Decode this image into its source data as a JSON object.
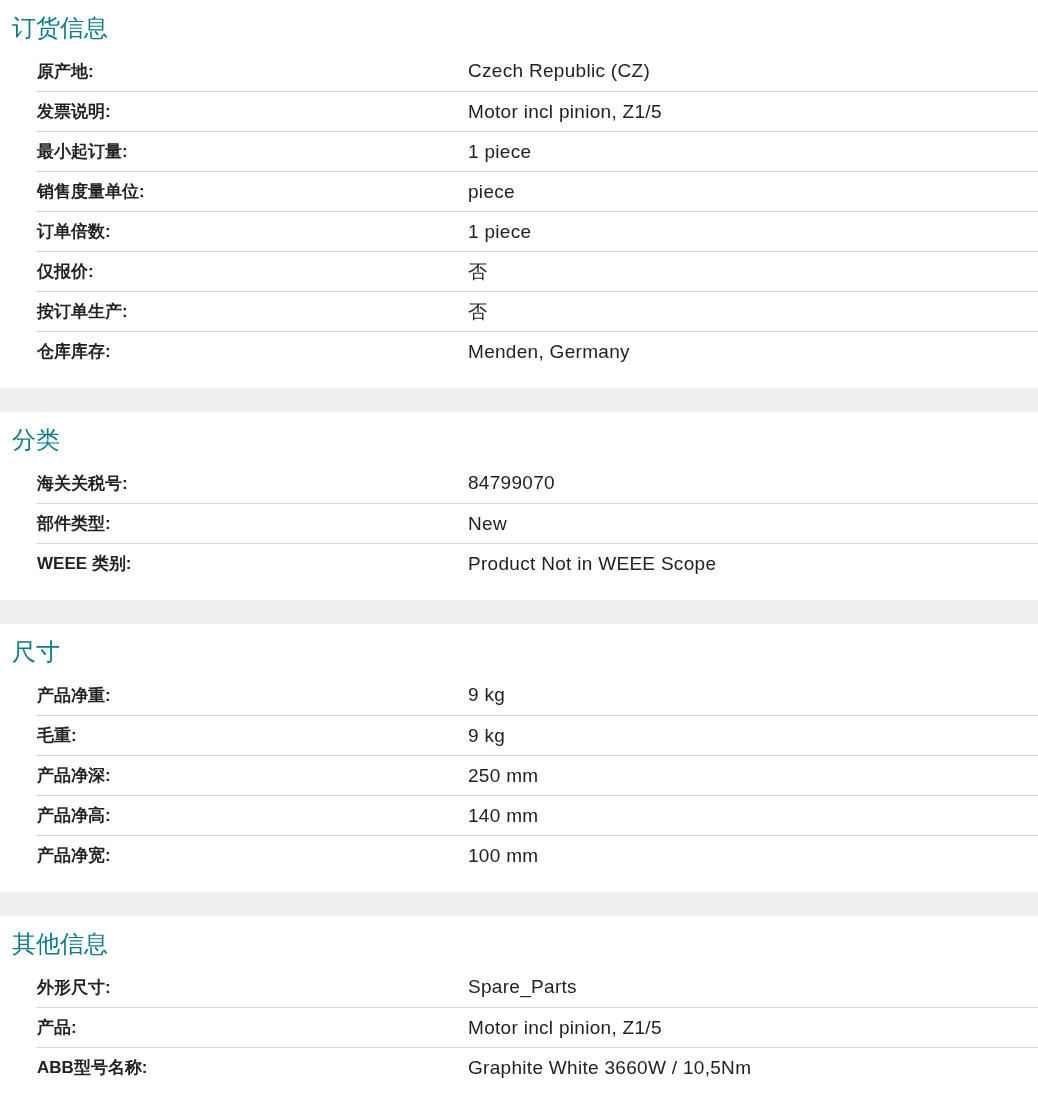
{
  "sections": [
    {
      "title": "订货信息",
      "rows": [
        {
          "label": "原产地:",
          "value": "Czech Republic (CZ)"
        },
        {
          "label": "发票说明:",
          "value": "Motor incl pinion, Z1/5"
        },
        {
          "label": "最小起订量:",
          "value": "1 piece"
        },
        {
          "label": "销售度量单位:",
          "value": "piece"
        },
        {
          "label": "订单倍数:",
          "value": "1 piece"
        },
        {
          "label": "仅报价:",
          "value": "否"
        },
        {
          "label": "按订单生产:",
          "value": "否"
        },
        {
          "label": "仓库库存:",
          "value": "Menden, Germany"
        }
      ]
    },
    {
      "title": "分类",
      "rows": [
        {
          "label": "海关关税号:",
          "value": "84799070"
        },
        {
          "label": "部件类型:",
          "value": "New"
        },
        {
          "label": "WEEE 类别:",
          "value": "Product Not in WEEE Scope"
        }
      ]
    },
    {
      "title": "尺寸",
      "rows": [
        {
          "label": "产品净重:",
          "value": "9 kg"
        },
        {
          "label": "毛重:",
          "value": "9 kg"
        },
        {
          "label": "产品净深:",
          "value": "250 mm"
        },
        {
          "label": "产品净高:",
          "value": "140 mm"
        },
        {
          "label": "产品净宽:",
          "value": "100 mm"
        }
      ]
    },
    {
      "title": "其他信息",
      "rows": [
        {
          "label": "外形尺寸:",
          "value": "Spare_Parts"
        },
        {
          "label": "产品:",
          "value": "Motor incl pinion, Z1/5"
        },
        {
          "label": "ABB型号名称:",
          "value": "Graphite White 3660W / 10,5Nm"
        }
      ]
    }
  ]
}
